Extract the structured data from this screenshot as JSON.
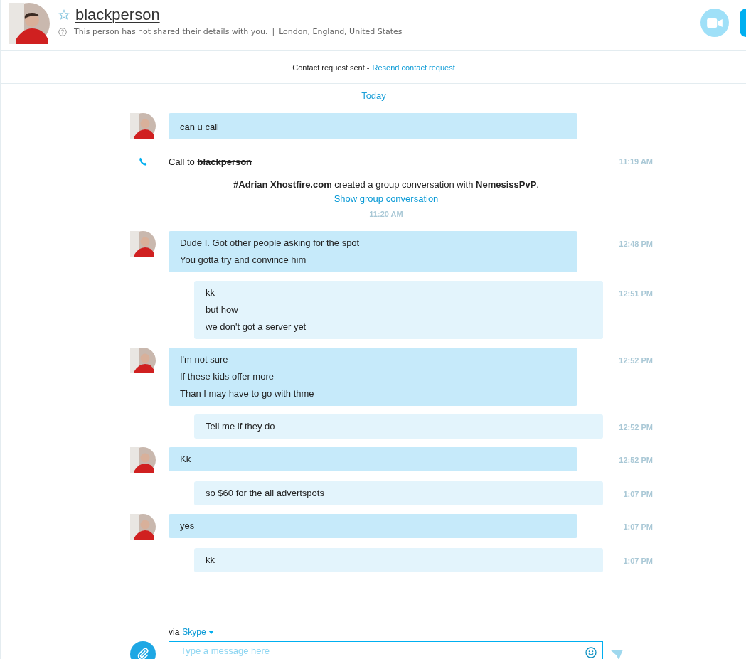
{
  "header": {
    "name": "blackperson",
    "favorite": false,
    "details": "This person has not shared their details with you.",
    "separator": "|",
    "location": "London, England, United States"
  },
  "contact_request": {
    "text": "Contact request sent -",
    "link": "Resend contact request"
  },
  "date_divider": "Today",
  "messages": [
    {
      "kind": "incoming",
      "lines": [
        "can u call"
      ]
    },
    {
      "kind": "call",
      "prefix": "Call to",
      "callee": "blackperson",
      "time": "11:19 AM"
    },
    {
      "kind": "event",
      "text": "**#Adrian Xhostfire.com** created a group conversation with **NemesissPvP**.",
      "link": "Show group conversation",
      "time": "11:20 AM"
    },
    {
      "kind": "incoming",
      "lines": [
        "Dude I. Got other people asking for the spot",
        "You gotta try and convince him"
      ],
      "time": "12:48 PM"
    },
    {
      "kind": "outgoing",
      "lines": [
        "kk",
        "but how",
        "we don't got a server yet"
      ],
      "time": "12:51 PM"
    },
    {
      "kind": "incoming",
      "lines": [
        "I'm not sure",
        "If these kids offer more",
        "Than I may have to go with thme"
      ],
      "time": "12:52 PM"
    },
    {
      "kind": "outgoing",
      "lines": [
        "Tell me if they do"
      ],
      "time": "12:52 PM"
    },
    {
      "kind": "incoming",
      "lines": [
        "Kk"
      ],
      "time": "12:52 PM"
    },
    {
      "kind": "outgoing",
      "lines": [
        "so $60 for the all advertspots"
      ],
      "time": "1:07 PM"
    },
    {
      "kind": "incoming",
      "lines": [
        "yes"
      ],
      "time": "1:07 PM"
    },
    {
      "kind": "outgoing",
      "lines": [
        "kk"
      ],
      "time": "1:07 PM"
    }
  ],
  "composer": {
    "via": "via",
    "service": "Skype",
    "placeholder": "Type a message here"
  }
}
